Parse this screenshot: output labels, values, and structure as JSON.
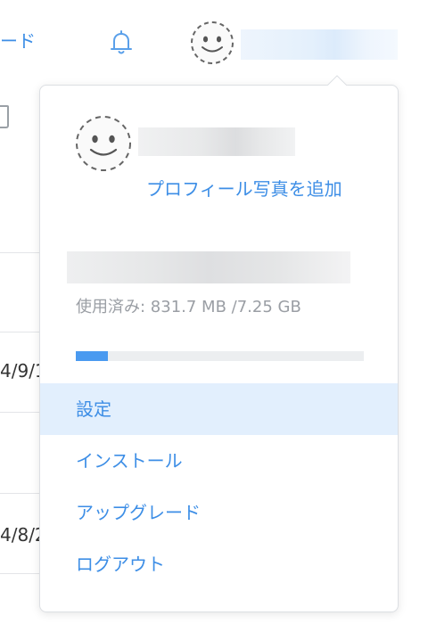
{
  "topbar": {
    "link_label": "ード",
    "bell_icon": "bell-icon",
    "avatar_icon": "smiley-avatar-icon"
  },
  "background": {
    "row_dates": [
      "4/9/1",
      "4/8/2"
    ]
  },
  "popover": {
    "add_photo_label": "プロフィール写真を追加",
    "usage": {
      "text": "使用済み: 831.7 MB /7.25 GB",
      "fraction": 0.112
    },
    "menu": [
      {
        "label": "設定",
        "active": true
      },
      {
        "label": "インストール",
        "active": false
      },
      {
        "label": "アップグレード",
        "active": false
      },
      {
        "label": "ログアウト",
        "active": false
      }
    ]
  },
  "colors": {
    "accent": "#3d8ee6",
    "active_bg": "#e2effd",
    "progress": "#4a9af0",
    "muted_text": "#9a9ea4"
  }
}
